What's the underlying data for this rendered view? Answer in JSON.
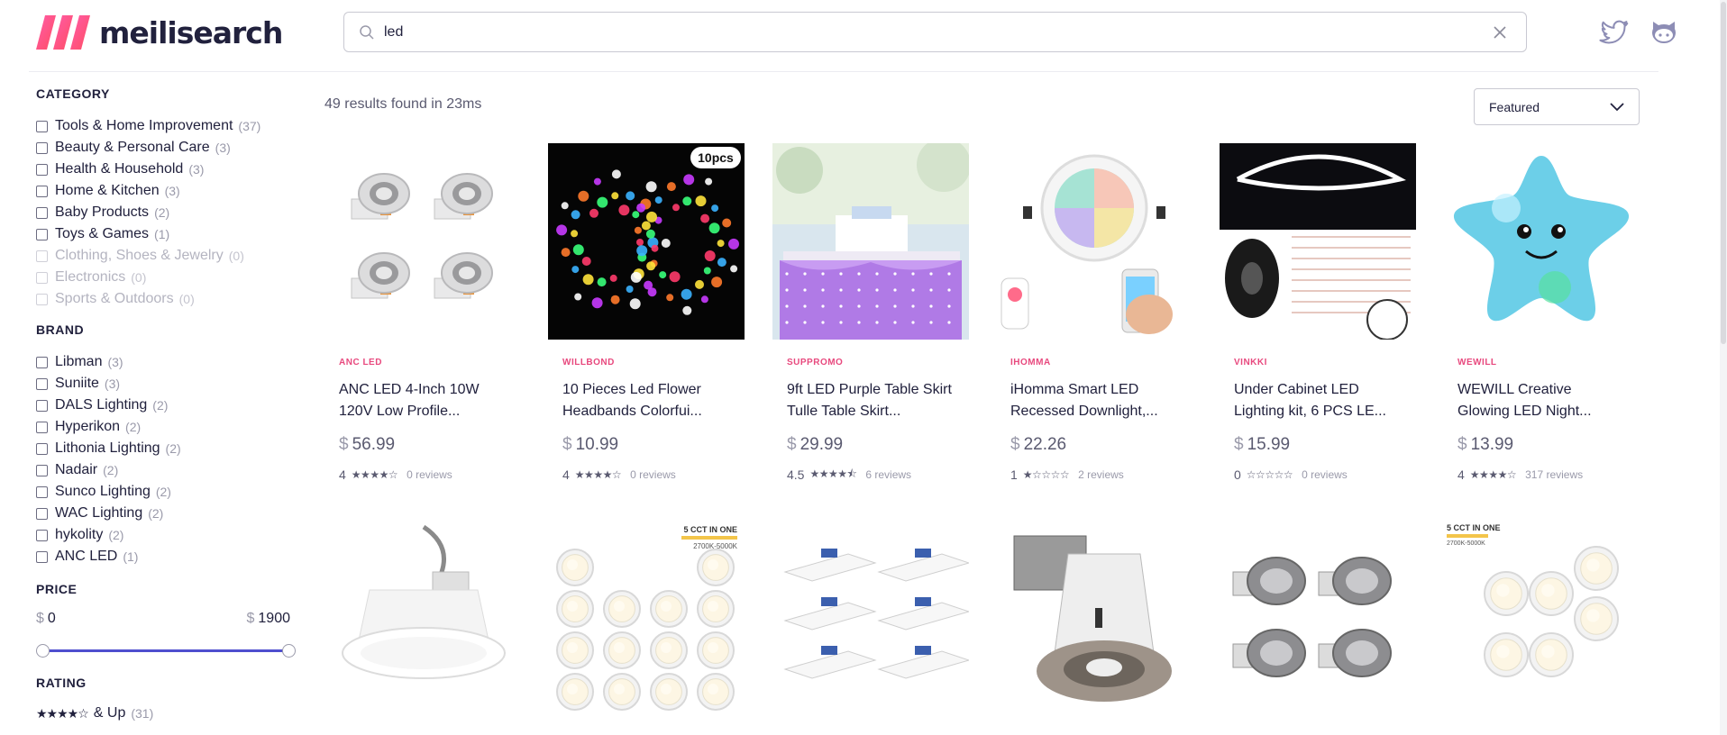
{
  "header": {
    "logo_text": "meilisearch",
    "search": {
      "value": "led",
      "placeholder": ""
    }
  },
  "sidebar": {
    "category_title": "CATEGORY",
    "categories": [
      {
        "label": "Tools & Home Improvement",
        "count": "(37)",
        "disabled": false
      },
      {
        "label": "Beauty & Personal Care",
        "count": "(3)",
        "disabled": false
      },
      {
        "label": "Health & Household",
        "count": "(3)",
        "disabled": false
      },
      {
        "label": "Home & Kitchen",
        "count": "(3)",
        "disabled": false
      },
      {
        "label": "Baby Products",
        "count": "(2)",
        "disabled": false
      },
      {
        "label": "Toys & Games",
        "count": "(1)",
        "disabled": false
      },
      {
        "label": "Clothing, Shoes & Jewelry",
        "count": "(0)",
        "disabled": true
      },
      {
        "label": "Electronics",
        "count": "(0)",
        "disabled": true
      },
      {
        "label": "Sports & Outdoors",
        "count": "(0)",
        "disabled": true
      }
    ],
    "brand_title": "BRAND",
    "brands": [
      {
        "label": "Libman",
        "count": "(3)"
      },
      {
        "label": "Suniite",
        "count": "(3)"
      },
      {
        "label": "DALS Lighting",
        "count": "(2)"
      },
      {
        "label": "Hyperikon",
        "count": "(2)"
      },
      {
        "label": "Lithonia Lighting",
        "count": "(2)"
      },
      {
        "label": "Nadair",
        "count": "(2)"
      },
      {
        "label": "Sunco Lighting",
        "count": "(2)"
      },
      {
        "label": "WAC Lighting",
        "count": "(2)"
      },
      {
        "label": "hykolity",
        "count": "(2)"
      },
      {
        "label": "ANC LED",
        "count": "(1)"
      }
    ],
    "price_title": "PRICE",
    "price": {
      "currency": "$",
      "min": "0",
      "max": "1900",
      "range_fraction": [
        0,
        1
      ]
    },
    "rating_title": "RATING",
    "rating": {
      "stars": "★★★★☆",
      "label": "& Up",
      "count": "(31)"
    }
  },
  "main": {
    "result_count": "49 results found in 23ms",
    "sort": {
      "selected": "Featured"
    },
    "products": [
      {
        "brand": "ANC LED",
        "title": "ANC LED 4-Inch 10W 120V Low Profile...",
        "currency": "$",
        "price": "56.99",
        "rating": "4",
        "stars": "★★★★☆",
        "reviews": "0 reviews",
        "image": "recessed-lights-4pack"
      },
      {
        "brand": "WILLBOND",
        "title": "10 Pieces Led Flower Headbands Colorfui...",
        "currency": "$",
        "price": "10.99",
        "rating": "4",
        "stars": "★★★★☆",
        "reviews": "0 reviews",
        "image": "flower-headbands",
        "badge": "10pcs"
      },
      {
        "brand": "SUPPROMO",
        "title": "9ft LED Purple Table Skirt Tulle Table Skirt...",
        "currency": "$",
        "price": "29.99",
        "rating": "4.5",
        "stars": "★★★★⯪",
        "reviews": "6 reviews",
        "image": "purple-table-skirt"
      },
      {
        "brand": "IHOMMA",
        "title": "iHomma Smart LED Recessed Downlight,...",
        "currency": "$",
        "price": "22.26",
        "rating": "1",
        "stars": "★☆☆☆☆",
        "reviews": "2 reviews",
        "image": "smart-downlight"
      },
      {
        "brand": "VINKKI",
        "title": "Under Cabinet LED Lighting kit, 6 PCS LE...",
        "currency": "$",
        "price": "15.99",
        "rating": "0",
        "stars": "☆☆☆☆☆",
        "reviews": "0 reviews",
        "image": "led-strip-kit"
      },
      {
        "brand": "WEWILL",
        "title": "WEWILL Creative Glowing LED Night...",
        "currency": "$",
        "price": "13.99",
        "rating": "4",
        "stars": "★★★★☆",
        "reviews": "317 reviews",
        "image": "star-pillow"
      }
    ],
    "products_row2": [
      {
        "image": "recessed-can-light"
      },
      {
        "image": "downlights-12pack",
        "badge_line1": "5 CCT IN ONE",
        "badge_line2": "2700K-5000K"
      },
      {
        "image": "slim-panel-lights"
      },
      {
        "image": "gimbal-housing"
      },
      {
        "image": "recessed-kits-4pack"
      },
      {
        "image": "downlights-6pack",
        "badge_line1": "5 CCT IN ONE",
        "badge_line2": "2700K-5000K"
      }
    ]
  },
  "colors": {
    "accent": "#4f4fcf",
    "brand_pink": "#e8497e",
    "text": "#21213d"
  }
}
